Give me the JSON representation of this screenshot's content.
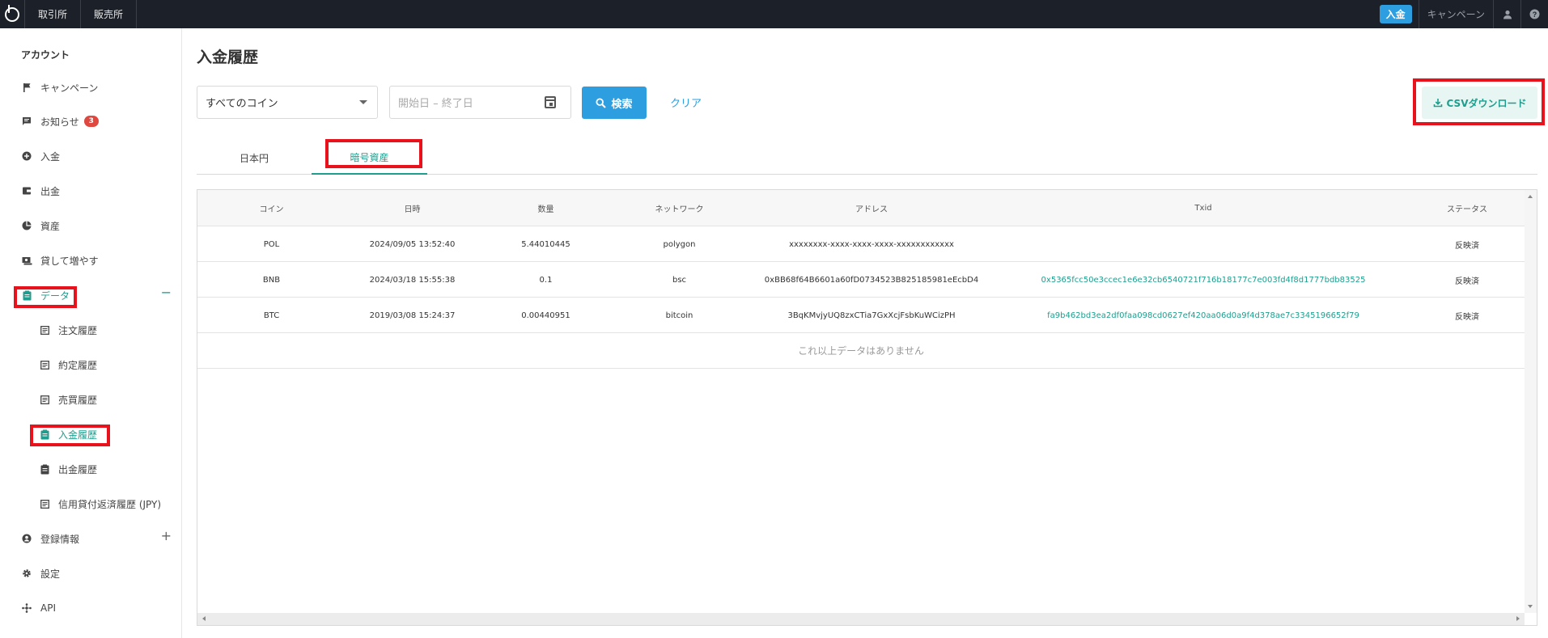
{
  "topbar": {
    "nav": [
      "取引所",
      "販売所"
    ],
    "deposit_label": "入金",
    "campaign_label": "キャンペーン"
  },
  "sidebar": {
    "title": "アカウント",
    "items": [
      {
        "label": "キャンペーン",
        "icon": "flag-icon"
      },
      {
        "label": "お知らせ",
        "icon": "message-icon",
        "badge": "3"
      },
      {
        "label": "入金",
        "icon": "plus-circle-icon"
      },
      {
        "label": "出金",
        "icon": "wallet-icon"
      },
      {
        "label": "資産",
        "icon": "pie-chart-icon"
      },
      {
        "label": "貸して増やす",
        "icon": "lend-icon"
      },
      {
        "label": "データ",
        "icon": "clipboard-icon",
        "toggle": "−"
      },
      {
        "label": "登録情報",
        "icon": "account-circle-icon",
        "toggle": "+"
      },
      {
        "label": "設定",
        "icon": "gear-icon"
      },
      {
        "label": "API",
        "icon": "api-icon"
      }
    ],
    "data_subitems": [
      {
        "label": "注文履歴"
      },
      {
        "label": "約定履歴"
      },
      {
        "label": "売買履歴"
      },
      {
        "label": "入金履歴"
      },
      {
        "label": "出金履歴"
      },
      {
        "label": "信用貸付返済履歴 (JPY)"
      }
    ]
  },
  "main": {
    "title": "入金履歴",
    "coin_select_value": "すべてのコイン",
    "date_placeholder": "開始日 – 終了日",
    "search_label": "検索",
    "clear_label": "クリア",
    "csv_label": "CSVダウンロード",
    "tabs": [
      {
        "label": "日本円"
      },
      {
        "label": "暗号資産"
      }
    ],
    "table": {
      "headers": [
        "コイン",
        "日時",
        "数量",
        "ネットワーク",
        "アドレス",
        "Txid",
        "ステータス"
      ],
      "rows": [
        {
          "coin": "POL",
          "datetime": "2024/09/05 13:52:40",
          "amount": "5.44010445",
          "network": "polygon",
          "address": "xxxxxxxx-xxxx-xxxx-xxxx-xxxxxxxxxxxx",
          "txid": "",
          "status": "反映済"
        },
        {
          "coin": "BNB",
          "datetime": "2024/03/18 15:55:38",
          "amount": "0.1",
          "network": "bsc",
          "address": "0xBB68f64B6601a60fD0734523B825185981eEcbD4",
          "txid": "0x5365fcc50e3ccec1e6e32cb6540721f716b18177c7e003fd4f8d1777bdb83525",
          "status": "反映済"
        },
        {
          "coin": "BTC",
          "datetime": "2019/03/08 15:24:37",
          "amount": "0.00440951",
          "network": "bitcoin",
          "address": "3BqKMvjyUQ8zxCTia7GxXcjFsbKuWCizPH",
          "txid": "fa9b462bd3ea2df0faa098cd0627ef420aa06d0a9f4d378ae7c3345196652f79",
          "status": "反映済"
        }
      ],
      "empty_message": "これ以上データはありません"
    }
  },
  "colors": {
    "accent": "#1e9e8e",
    "primary": "#2d9ee0",
    "highlight": "#e8121d",
    "topbar": "#1c2028"
  }
}
